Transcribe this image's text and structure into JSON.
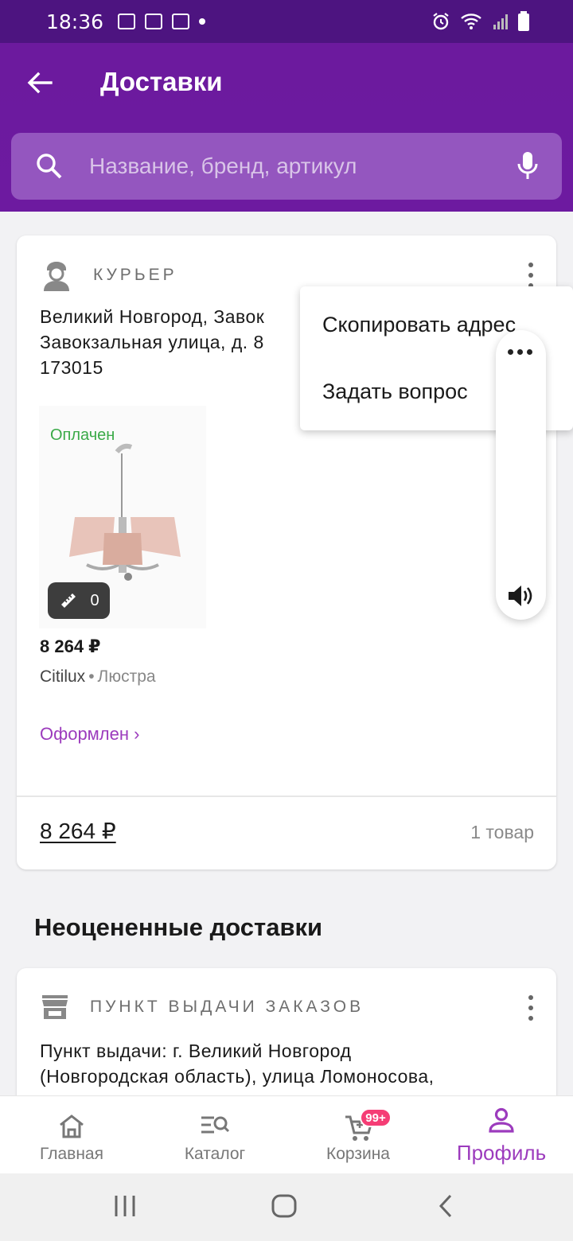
{
  "status_bar": {
    "time": "18:36"
  },
  "header": {
    "title": "Доставки"
  },
  "search": {
    "placeholder": "Название, бренд, артикул"
  },
  "delivery_card": {
    "type_label": "КУРЬЕР",
    "address_line1": "Великий Новгород, Завокзальная улица, д. 8",
    "address_line2": "Завокзальная улица, д. 8",
    "address_line3": "173015",
    "address_visible_1": "Великий Новгород, Завок",
    "address_visible_2": "Завокзальная улица, д. 8",
    "product": {
      "payment_status": "Оплачен",
      "fitting_count": "0",
      "price": "8 264 ₽",
      "brand": "Citilux",
      "separator": "•",
      "category": "Люстра",
      "order_status": "Оформлен ›"
    },
    "total": "8 264 ₽",
    "item_count": "1 товар"
  },
  "context_menu": {
    "items": [
      "Скопировать адрес",
      "Задать вопрос"
    ]
  },
  "section": {
    "title": "Неоцененные доставки"
  },
  "second_card": {
    "type_label": "ПУНКТ ВЫДАЧИ ЗАКАЗОВ",
    "address_line1": "Пункт выдачи: г. Великий Новгород",
    "address_line2": "(Новгородская область), улица Ломоносова,"
  },
  "bottom_nav": {
    "items": [
      {
        "label": "Главная",
        "icon": "home-icon"
      },
      {
        "label": "Каталог",
        "icon": "catalog-search-icon"
      },
      {
        "label": "Корзина",
        "icon": "cart-icon",
        "badge": "99+"
      },
      {
        "label": "Профиль",
        "icon": "profile-icon",
        "active": true
      }
    ]
  },
  "colors": {
    "primary": "#6c1a9e",
    "accent": "#9c3bbd",
    "paid": "#3aaa48",
    "badge": "#f53d75"
  }
}
